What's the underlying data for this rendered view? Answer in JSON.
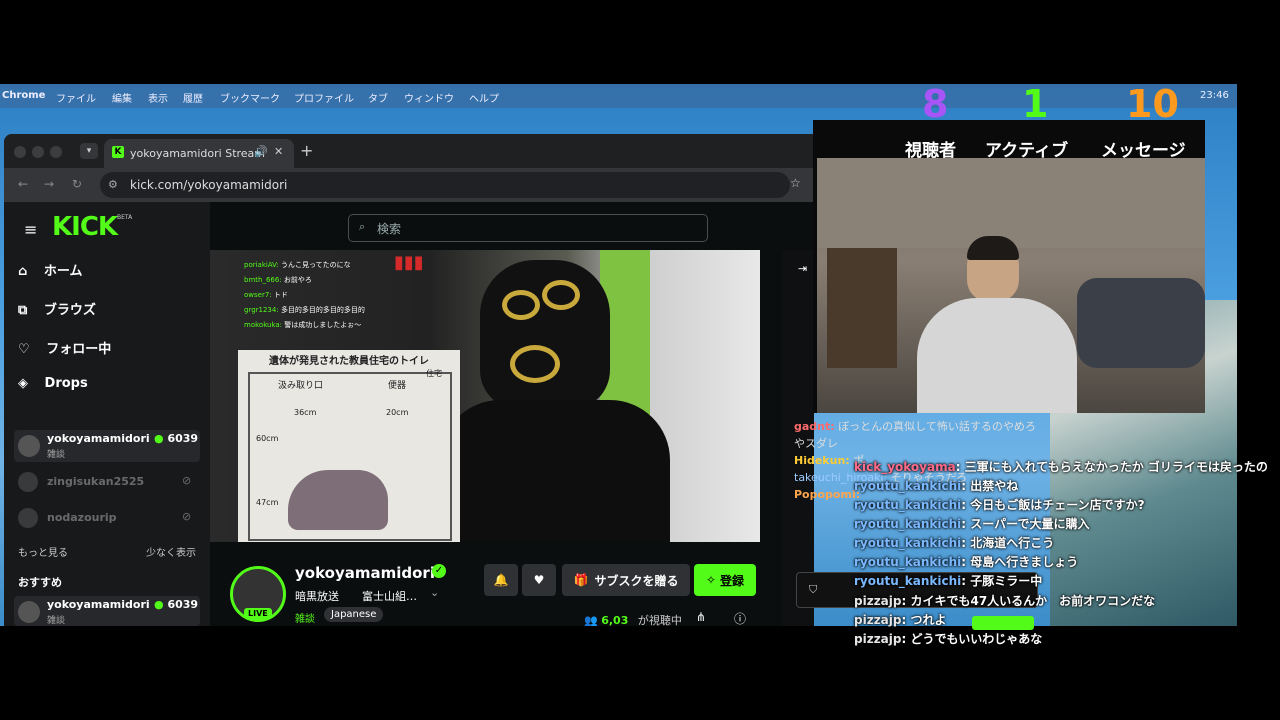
{
  "menubar": {
    "app": "Chrome",
    "items": [
      "ファイル",
      "編集",
      "表示",
      "履歴",
      "ブックマーク",
      "プロファイル",
      "タブ",
      "ウィンドウ",
      "ヘルプ"
    ],
    "time": "23:46"
  },
  "counters": {
    "viewers": "8",
    "active": "1",
    "messages": "10",
    "viewers_label": "視聴者",
    "active_label": "アクティブ",
    "messages_label": "メッセージ"
  },
  "browser": {
    "tab_title": "yokoyamamidori Stream",
    "url": "kick.com/yokoyamamidori"
  },
  "kick": {
    "logo": "KICK",
    "logo_badge": "BETA",
    "search_placeholder": "検索",
    "nav": [
      {
        "label": "ホーム",
        "icon": "home-icon"
      },
      {
        "label": "ブラウズ",
        "icon": "browse-icon"
      },
      {
        "label": "フォロー中",
        "icon": "heart-icon"
      },
      {
        "label": "Drops",
        "icon": "drops-icon"
      }
    ],
    "following": [
      {
        "name": "yokoyamamidori",
        "cat": "雑談",
        "viewers": "6039",
        "live": true
      },
      {
        "name": "zingisukan2525",
        "cat": "",
        "viewers": "",
        "live": false
      },
      {
        "name": "nodazourip",
        "cat": "",
        "viewers": "",
        "live": false
      }
    ],
    "show_more": "もっと見る",
    "show_less": "少なく表示",
    "recommended_label": "おすすめ",
    "recommended": [
      {
        "name": "yokoyamamidori",
        "cat": "雑談",
        "viewers": "6039"
      }
    ],
    "channel": {
      "name": "yokoyamamidori",
      "title": "暗黒放送",
      "subtitle": "富士山組…",
      "category": "雑談",
      "tag": "Japanese",
      "live_badge": "LIVE",
      "viewers": "6,03",
      "viewers_suffix": "が視聴中",
      "gift_label": "サブスクを贈る",
      "subscribe_label": "登録"
    },
    "video_overlay_chat": [
      {
        "user": "poriakiAV:",
        "msg": "うんこ見ってたのにな"
      },
      {
        "user": "bmth_666:",
        "msg": "お前やろ"
      },
      {
        "user": "owser7:",
        "msg": "トド"
      },
      {
        "user": "grgr1234:",
        "msg": "多目的多目的多目的多目的"
      },
      {
        "user": "mokokuka:",
        "msg": "警は成功しましたよぉ〜"
      }
    ],
    "diagram": {
      "title": "遺体が発見された教員住宅のトイレ",
      "label1": "汲み取り口",
      "label2": "便器",
      "label3": "住宅",
      "dim1": "36cm",
      "dim2": "20cm",
      "dim3": "60cm",
      "dim4": "47cm"
    },
    "side_chat": [
      {
        "user": "gadnt:",
        "msg": "ぼっとんの真似して怖い話するのやめろやスダレ"
      },
      {
        "user": "Hidekun:",
        "msg": "ポ"
      },
      {
        "user": "takeuchi_hiroaki:",
        "msg": "そりゃそうだろ"
      },
      {
        "user": "Popopomi:",
        "msg": ""
      }
    ]
  },
  "overlay_chat": [
    {
      "user": "kick_yokoyama",
      "msg": "三軍にも入れてもらえなかったか ゴリライモは戻ったの"
    },
    {
      "user": "ryoutu_kankichi",
      "msg": "出禁やね"
    },
    {
      "user": "ryoutu_kankichi",
      "msg": "今日もご飯はチェーン店ですか?"
    },
    {
      "user": "ryoutu_kankichi",
      "msg": "スーパーで大量に購入"
    },
    {
      "user": "ryoutu_kankichi",
      "msg": "北海道へ行こう"
    },
    {
      "user": "ryoutu_kankichi",
      "msg": "母島へ行きましょう"
    },
    {
      "user": "ryoutu_kankichi",
      "msg": "子豚ミラー中"
    },
    {
      "user": "pizzajp",
      "msg": "カイキでも47人いるんか　お前オワコンだな"
    },
    {
      "user": "pizzajp",
      "msg": "つれよ"
    },
    {
      "user": "pizzajp",
      "msg": "どうでもいいわじゃあな"
    }
  ],
  "colors": {
    "kick_green": "#53fc18",
    "purple": "#a855f7",
    "orange": "#ff9a1f"
  }
}
